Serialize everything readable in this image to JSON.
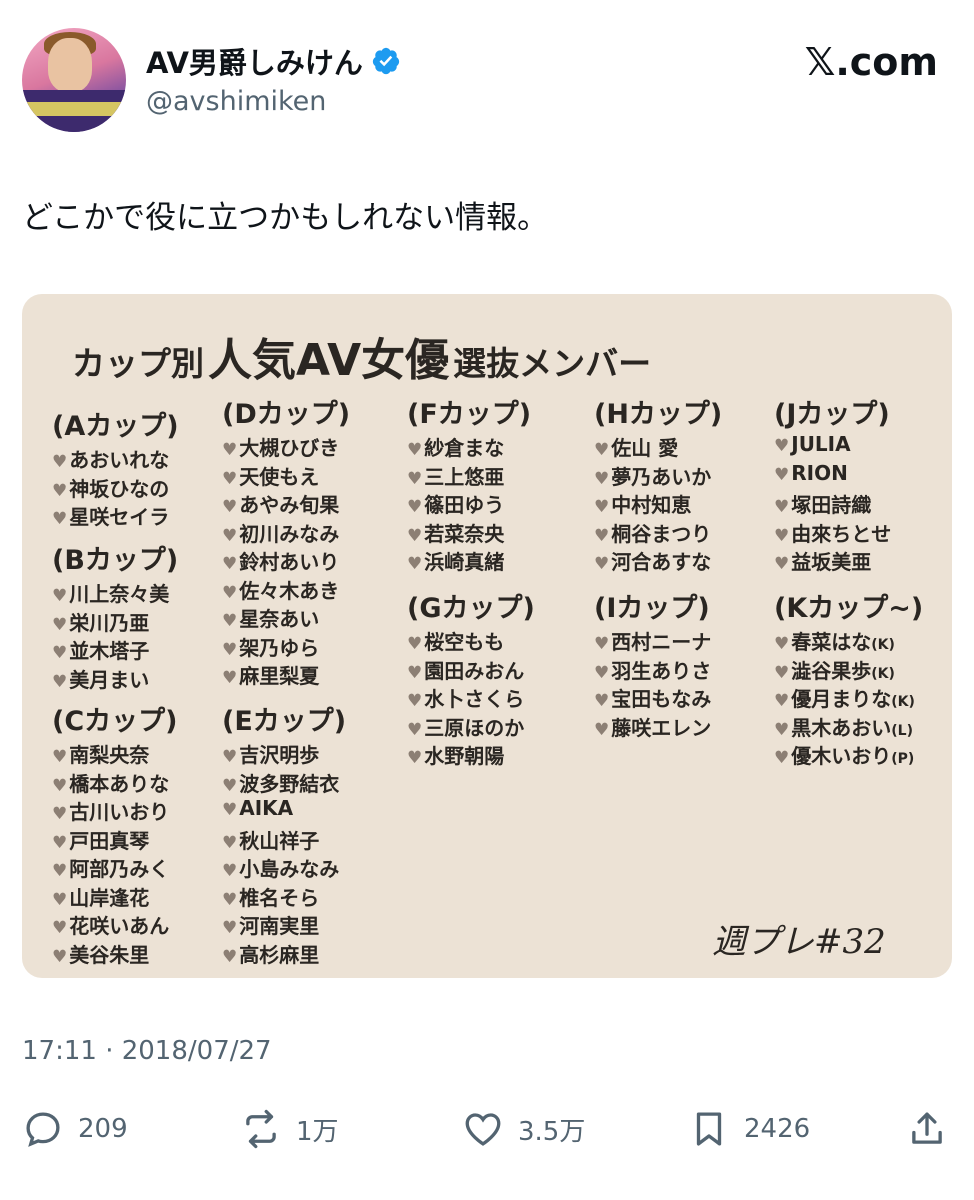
{
  "profile": {
    "display_name": "AV男爵しみけん",
    "handle": "@avshimiken",
    "verified": true,
    "avatar_icon": "profile-photo"
  },
  "brand": "𝕏.com",
  "tweet": {
    "text": "どこかで役に立つかもしれない情報。",
    "timestamp": "17:11 · 2018/07/27"
  },
  "image": {
    "title_a": "カップ別",
    "title_b": "人気AV女優",
    "title_c": "選抜メンバー",
    "signature": "週プレ#32",
    "groups": [
      {
        "cup": "(Aカップ)",
        "members": [
          {
            "name": "あおいれな"
          },
          {
            "name": "神坂ひなの"
          },
          {
            "name": "星咲セイラ"
          }
        ]
      },
      {
        "cup": "(Bカップ)",
        "members": [
          {
            "name": "川上奈々美"
          },
          {
            "name": "栄川乃亜"
          },
          {
            "name": "並木塔子"
          },
          {
            "name": "美月まい"
          }
        ]
      },
      {
        "cup": "(Cカップ)",
        "members": [
          {
            "name": "南梨央奈"
          },
          {
            "name": "橋本ありな"
          },
          {
            "name": "古川いおり"
          },
          {
            "name": "戸田真琴"
          },
          {
            "name": "阿部乃みく"
          },
          {
            "name": "山岸逢花"
          },
          {
            "name": "花咲いあん"
          },
          {
            "name": "美谷朱里"
          }
        ]
      },
      {
        "cup": "(Dカップ)",
        "members": [
          {
            "name": "大槻ひびき"
          },
          {
            "name": "天使もえ"
          },
          {
            "name": "あやみ旬果"
          },
          {
            "name": "初川みなみ"
          },
          {
            "name": "鈴村あいり"
          },
          {
            "name": "佐々木あき"
          },
          {
            "name": "星奈あい"
          },
          {
            "name": "架乃ゆら"
          },
          {
            "name": "麻里梨夏"
          }
        ]
      },
      {
        "cup": "(Eカップ)",
        "members": [
          {
            "name": "吉沢明歩"
          },
          {
            "name": "波多野結衣"
          },
          {
            "name": "AIKA"
          },
          {
            "name": "秋山祥子"
          },
          {
            "name": "小島みなみ"
          },
          {
            "name": "椎名そら"
          },
          {
            "name": "河南実里"
          },
          {
            "name": "高杉麻里"
          }
        ]
      },
      {
        "cup": "(Fカップ)",
        "members": [
          {
            "name": "紗倉まな"
          },
          {
            "name": "三上悠亜"
          },
          {
            "name": "篠田ゆう"
          },
          {
            "name": "若菜奈央"
          },
          {
            "name": "浜崎真緒"
          }
        ]
      },
      {
        "cup": "(Gカップ)",
        "members": [
          {
            "name": "桜空もも"
          },
          {
            "name": "園田みおん"
          },
          {
            "name": "水卜さくら"
          },
          {
            "name": "三原ほのか"
          },
          {
            "name": "水野朝陽"
          }
        ]
      },
      {
        "cup": "(Hカップ)",
        "members": [
          {
            "name": "佐山 愛"
          },
          {
            "name": "夢乃あいか"
          },
          {
            "name": "中村知恵"
          },
          {
            "name": "桐谷まつり"
          },
          {
            "name": "河合あすな"
          }
        ]
      },
      {
        "cup": "(Iカップ)",
        "members": [
          {
            "name": "西村ニーナ"
          },
          {
            "name": "羽生ありさ"
          },
          {
            "name": "宝田もなみ"
          },
          {
            "name": "藤咲エレン"
          }
        ]
      },
      {
        "cup": "(Jカップ)",
        "members": [
          {
            "name": "JULIA"
          },
          {
            "name": "RION"
          },
          {
            "name": "塚田詩織"
          },
          {
            "name": "由來ちとせ"
          },
          {
            "name": "益坂美亜"
          }
        ]
      },
      {
        "cup": "(Kカップ~)",
        "members": [
          {
            "name": "春菜はな",
            "note": "(K)"
          },
          {
            "name": "澁谷果歩",
            "note": "(K)"
          },
          {
            "name": "優月まりな",
            "note": "(K)"
          },
          {
            "name": "黒木あおい",
            "note": "(L)"
          },
          {
            "name": "優木いおり",
            "note": "(P)"
          }
        ]
      }
    ]
  },
  "actions": {
    "replies": "209",
    "reposts": "1万",
    "likes": "3.5万",
    "bookmarks": "2426"
  }
}
